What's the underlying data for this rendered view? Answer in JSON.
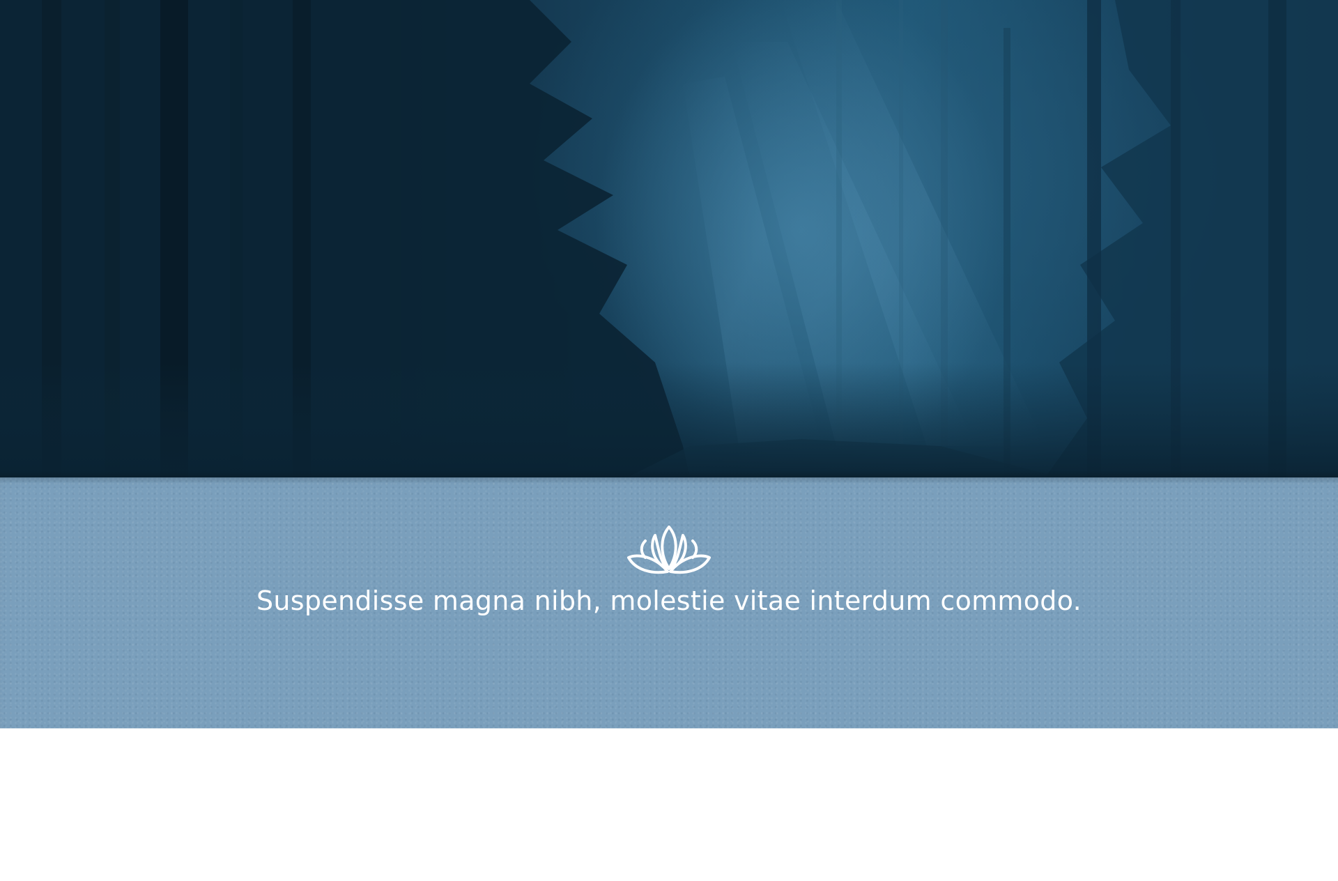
{
  "hero": {
    "icon": "forest-photo"
  },
  "band": {
    "icon": "lotus-icon",
    "tagline": "Suspendisse magna nibh, molestie vitae interdum commodo.",
    "color": "#7a9fbc"
  },
  "colors": {
    "hero_dark": "#0d2a3e",
    "hero_mid": "#1f5877",
    "text": "#ffffff"
  }
}
